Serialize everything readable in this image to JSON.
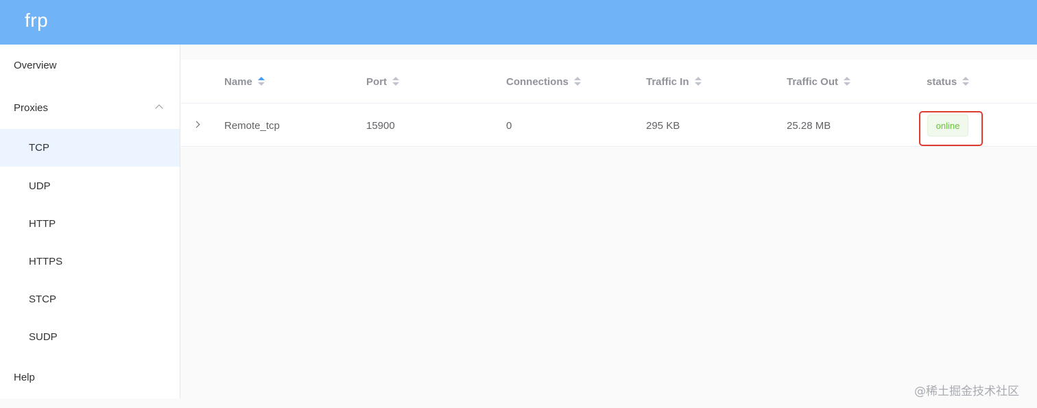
{
  "app": {
    "logo": "frp"
  },
  "sidebar": {
    "items": [
      {
        "label": "Overview"
      },
      {
        "label": "Proxies"
      },
      {
        "label": "TCP"
      },
      {
        "label": "UDP"
      },
      {
        "label": "HTTP"
      },
      {
        "label": "HTTPS"
      },
      {
        "label": "STCP"
      },
      {
        "label": "SUDP"
      },
      {
        "label": "Help"
      }
    ],
    "active": "TCP"
  },
  "table": {
    "columns": [
      "Name",
      "Port",
      "Connections",
      "Traffic In",
      "Traffic Out",
      "status"
    ],
    "sort": {
      "column": "Name",
      "direction": "asc"
    },
    "rows": [
      {
        "name": "Remote_tcp",
        "port": "15900",
        "connections": "0",
        "traffic_in": "295 KB",
        "traffic_out": "25.28 MB",
        "status": "online"
      }
    ]
  },
  "colors": {
    "header": "#70b4f7",
    "active_menu_bg": "#ecf5ff",
    "status_online": "#67c23a",
    "highlight_box": "#e03b2f",
    "sort_active": "#409eff"
  },
  "watermark": "@稀土掘金技术社区"
}
